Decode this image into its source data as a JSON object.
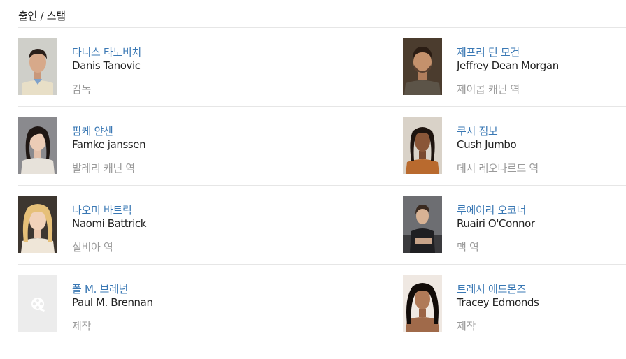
{
  "section": {
    "title": "출연 / 스탭"
  },
  "cast": [
    {
      "name_ko": "다니스 타노비치",
      "name_en": "Danis Tanovic",
      "role": "감독",
      "photo_icon": "person-photo"
    },
    {
      "name_ko": "제프리 딘 모건",
      "name_en": "Jeffrey Dean Morgan",
      "role": "제이콥 캐닌 역",
      "photo_icon": "person-photo"
    },
    {
      "name_ko": "팜케 얀센",
      "name_en": "Famke janssen",
      "role": "발레리 캐닌 역",
      "photo_icon": "person-photo"
    },
    {
      "name_ko": "쿠시 점보",
      "name_en": "Cush Jumbo",
      "role": "데시 레오나르드 역",
      "photo_icon": "person-photo"
    },
    {
      "name_ko": "나오미 바트릭",
      "name_en": "Naomi Battrick",
      "role": "실비아 역",
      "photo_icon": "person-photo"
    },
    {
      "name_ko": "루에이리 오코너",
      "name_en": "Ruairi O'Connor",
      "role": "맥 역",
      "photo_icon": "person-photo"
    },
    {
      "name_ko": "폴 M. 브레넌",
      "name_en": "Paul M. Brennan",
      "role": "제작",
      "photo_icon": "film-reel-placeholder-icon"
    },
    {
      "name_ko": "트레시 에드몬즈",
      "name_en": "Tracey Edmonds",
      "role": "제작",
      "photo_icon": "person-photo"
    }
  ]
}
